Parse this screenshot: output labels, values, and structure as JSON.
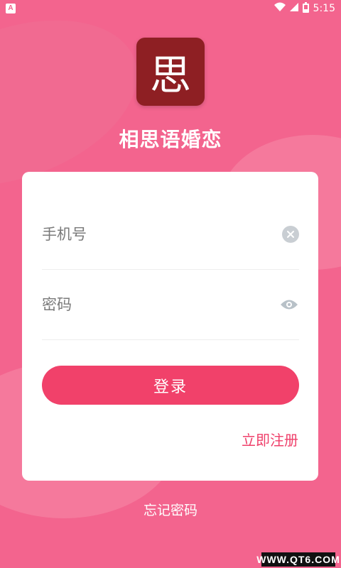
{
  "status_bar": {
    "left_badge": "A",
    "time": "5:15",
    "icons": [
      "wifi-icon",
      "signal-icon",
      "battery-icon"
    ]
  },
  "app": {
    "logo_char": "思",
    "title": "相思语婚恋"
  },
  "login_form": {
    "phone_placeholder": "手机号",
    "phone_value": "",
    "password_placeholder": "密码",
    "password_value": "",
    "login_label": "登录",
    "register_label": "立即注册"
  },
  "forgot_label": "忘记密码",
  "watermark": "WWW.QT6.COM",
  "colors": {
    "background": "#f3648e",
    "accent": "#f1416a",
    "logo_bg": "#8e1f23",
    "card": "#ffffff"
  }
}
